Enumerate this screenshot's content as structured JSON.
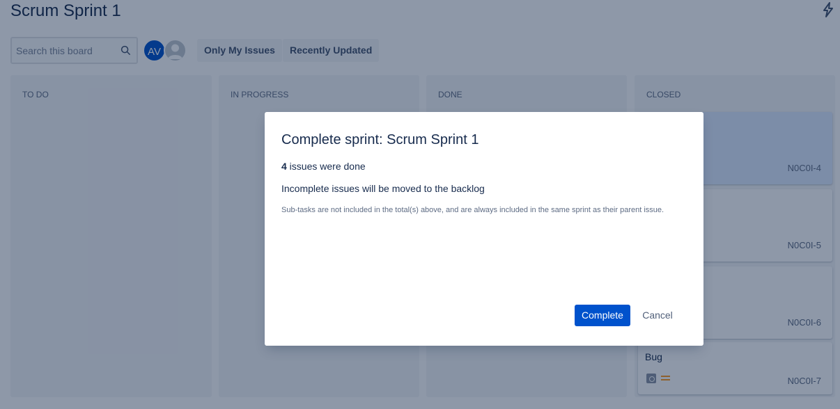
{
  "board": {
    "title": "Scrum Sprint 1",
    "search": {
      "placeholder": "Search this board"
    },
    "avatars": [
      {
        "initials": "AV"
      }
    ],
    "filters": [
      "Only My Issues",
      "Recently Updated"
    ],
    "columns": [
      {
        "title": "TO DO"
      },
      {
        "title": "IN PROGRESS"
      },
      {
        "title": "DONE"
      },
      {
        "title": "CLOSED"
      }
    ],
    "closed_cards": [
      {
        "key": "N0C0I-4",
        "summary": "",
        "selected": true
      },
      {
        "key": "N0C0I-5",
        "summary": ""
      },
      {
        "key": "N0C0I-6",
        "summary": ""
      },
      {
        "key": "N0C0I-7",
        "summary": "Bug"
      }
    ]
  },
  "modal": {
    "title": "Complete sprint: Scrum Sprint 1",
    "done_count": "4",
    "done_text": " issues were done",
    "backlog_text": "Incomplete issues will be moved to the backlog",
    "note": "Sub-tasks are not included in the total(s) above, and are always included in the same sprint as their parent issue.",
    "complete_label": "Complete",
    "cancel_label": "Cancel"
  },
  "colors": {
    "primary": "#0052cc",
    "text": "#172b4d",
    "blanket": "rgba(9,30,66,0.46)",
    "priority": "#ff991f"
  }
}
